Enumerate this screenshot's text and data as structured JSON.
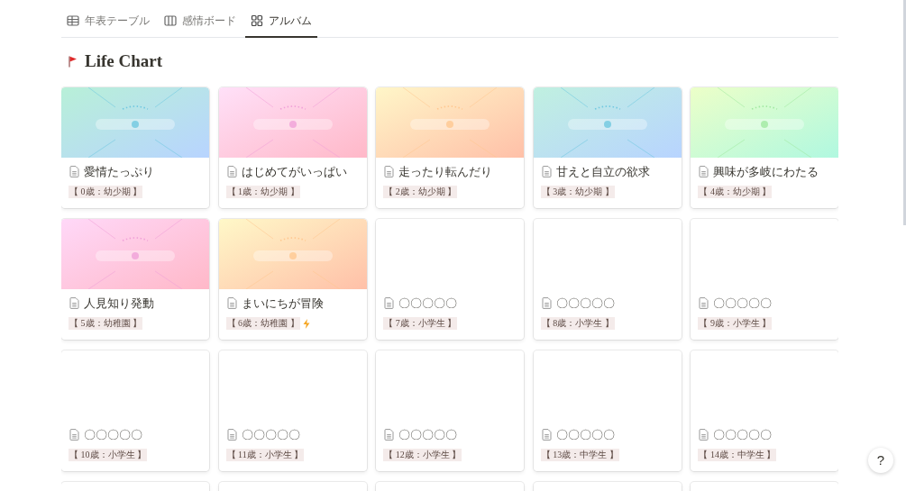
{
  "tabs": [
    {
      "label": "年表テーブル",
      "selected": false
    },
    {
      "label": "感情ボード",
      "selected": false
    },
    {
      "label": "アルバム",
      "selected": true
    }
  ],
  "page_title": "Life Chart",
  "cards": [
    {
      "kind": "picture",
      "title": "愛情たっぷり",
      "tag": "【 0歳：幼少期 】",
      "flash": false
    },
    {
      "kind": "picture",
      "title": "はじめてがいっぱい",
      "tag": "【 1歳：幼少期 】",
      "flash": false
    },
    {
      "kind": "picture",
      "title": "走ったり転んだり",
      "tag": "【 2歳：幼少期 】",
      "flash": false
    },
    {
      "kind": "picture",
      "title": "甘えと自立の欲求",
      "tag": "【 3歳：幼少期 】",
      "flash": false
    },
    {
      "kind": "picture",
      "title": "興味が多岐にわたる",
      "tag": "【 4歳：幼少期 】",
      "flash": false
    },
    {
      "kind": "picture",
      "title": "人見知り発動",
      "tag": "【 5歳：幼稚園 】",
      "flash": false
    },
    {
      "kind": "picture",
      "title": "まいにちが冒険",
      "tag": "【 6歳：幼稚園 】",
      "flash": true
    },
    {
      "kind": "blank",
      "title": "〇〇〇〇〇",
      "tag": "【 7歳：小学生 】",
      "flash": false
    },
    {
      "kind": "blank",
      "title": "〇〇〇〇〇",
      "tag": "【 8歳：小学生 】",
      "flash": false
    },
    {
      "kind": "blank",
      "title": "〇〇〇〇〇",
      "tag": "【 9歳：小学生 】",
      "flash": false
    },
    {
      "kind": "blank",
      "title": "〇〇〇〇〇",
      "tag": "【 10歳：小学生 】",
      "flash": false
    },
    {
      "kind": "blank",
      "title": "〇〇〇〇〇",
      "tag": "【 11歳：小学生 】",
      "flash": false
    },
    {
      "kind": "blank",
      "title": "〇〇〇〇〇",
      "tag": "【 12歳：小学生 】",
      "flash": false
    },
    {
      "kind": "blank",
      "title": "〇〇〇〇〇",
      "tag": "【 13歳：中学生 】",
      "flash": false
    },
    {
      "kind": "blank",
      "title": "〇〇〇〇〇",
      "tag": "【 14歳：中学生 】",
      "flash": false
    },
    {
      "kind": "blank"
    },
    {
      "kind": "blank"
    },
    {
      "kind": "blank"
    },
    {
      "kind": "blank"
    },
    {
      "kind": "blank"
    }
  ],
  "help_button": "?"
}
